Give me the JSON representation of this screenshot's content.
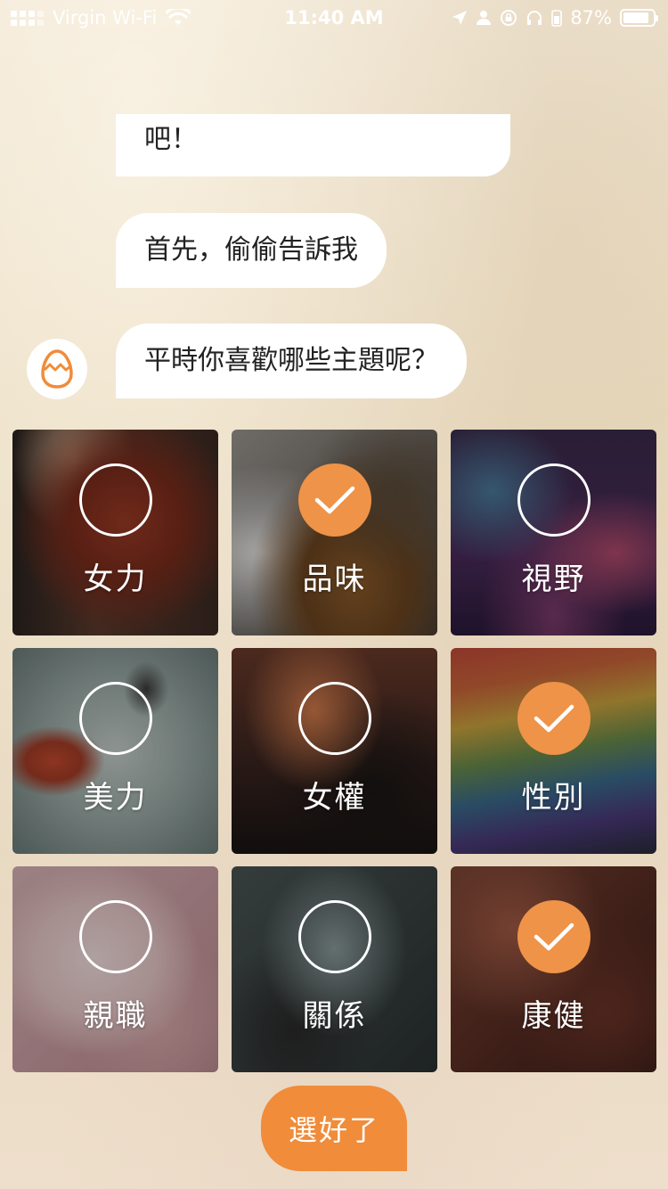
{
  "status_bar": {
    "carrier": "Virgin Wi-Fi",
    "time": "11:40 AM",
    "battery": "87%",
    "battery_level": 0.87
  },
  "chat": {
    "messages": [
      {
        "text": "吧！"
      },
      {
        "text": "首先，偷偷告訴我"
      },
      {
        "text": "平時你喜歡哪些主題呢？"
      }
    ],
    "bot_avatar_icon": "egg-icon"
  },
  "topics": [
    {
      "label": "女力",
      "selected": false
    },
    {
      "label": "品味",
      "selected": true
    },
    {
      "label": "視野",
      "selected": false
    },
    {
      "label": "美力",
      "selected": false
    },
    {
      "label": "女權",
      "selected": false
    },
    {
      "label": "性別",
      "selected": true
    },
    {
      "label": "親職",
      "selected": false
    },
    {
      "label": "關係",
      "selected": false
    },
    {
      "label": "康健",
      "selected": true
    }
  ],
  "done_button": {
    "label": "選好了"
  },
  "colors": {
    "accent": "#f08c3a",
    "check_fill": "#ef9348",
    "bubble": "#ffffff"
  }
}
